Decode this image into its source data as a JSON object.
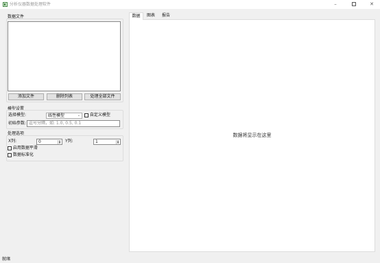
{
  "window": {
    "title": "分析仪器数据处理软件",
    "controls": {
      "minimize": "–",
      "maximize": "",
      "close": "✕"
    }
  },
  "files_group": {
    "title": "数据文件",
    "buttons": {
      "add": "添加文件",
      "remove": "删除列表",
      "process_all": "处理全部文件"
    }
  },
  "model_group": {
    "title": "模型设置",
    "select_label": "选择模型:",
    "selected_model": "线性模型",
    "custom_model_label": "自定义模型",
    "custom_model_checked": false,
    "init_params_label": "初始参数:",
    "init_params_placeholder": "逗号分隔，如: 1.0, 0.5, 0.1"
  },
  "processing_group": {
    "title": "处理选项",
    "x_label": "X列:",
    "x_value": "0",
    "y_label": "Y列:",
    "y_value": "1",
    "smooth_label": "启用数据平滑",
    "smooth_checked": false,
    "normalize_label": "数据标准化",
    "normalize_checked": false
  },
  "tabs": [
    {
      "label": "数据",
      "active": true
    },
    {
      "label": "图表",
      "active": false
    },
    {
      "label": "报告",
      "active": false
    }
  ],
  "data_area": {
    "placeholder": "数据将显示在这里"
  },
  "status_bar": {
    "text": "就绪"
  }
}
